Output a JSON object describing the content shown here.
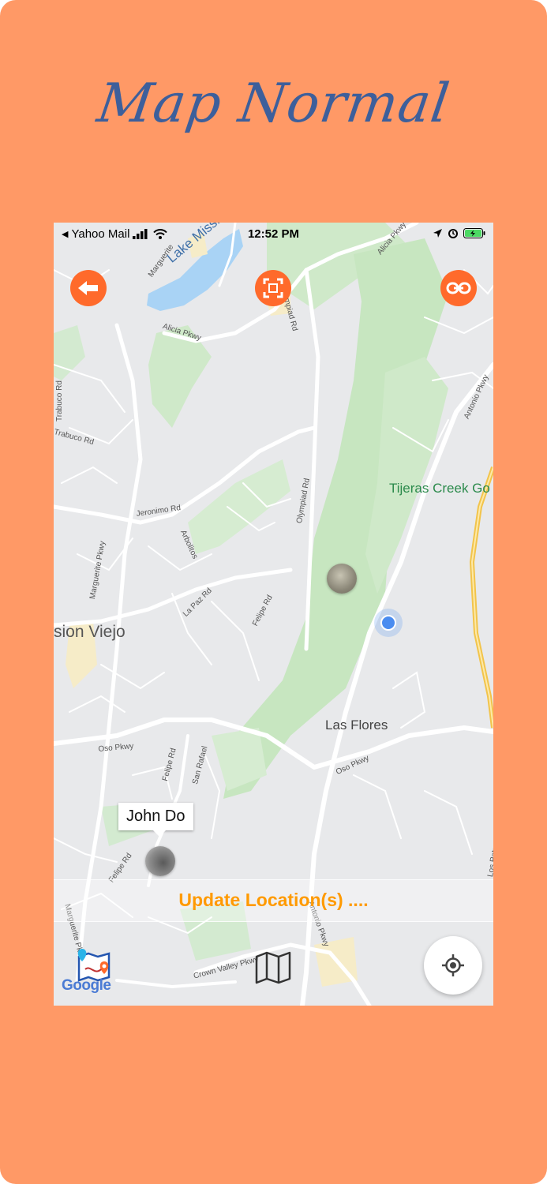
{
  "poster": {
    "title": "Map Normal",
    "background": "#FF9966",
    "title_color": "#3D5F9B"
  },
  "status_bar": {
    "back_app": "Yahoo Mail",
    "time": "12:52 PM"
  },
  "map_labels": {
    "lake": "Lake Mission Viejo",
    "city": "sion Viejo",
    "las_flores": "Las Flores",
    "tijeras": "Tijeras Creek Go",
    "roads": {
      "marguerite_top": "Marguerite",
      "alicia_top": "Alicia Pkwy",
      "alicia_left": "Alicia Pkwy",
      "olympiad_top": "Olympiad Rd",
      "olympiad_mid": "Olympiad Rd",
      "trabuco_vert": "Trabuco Rd",
      "trabuco_left": "Trabuco Rd",
      "jeronimo": "Jeronimo Rd",
      "marguerite_mid": "Marguerite Pkwy",
      "arbolitos": "Arbolitos",
      "la_paz": "La Paz Rd",
      "felipe_mid": "Felipe Rd",
      "felipe_low": "Felipe Rd",
      "felipe_bottom": "Felipe Rd",
      "oso_left": "Oso Pkwy",
      "oso_right": "Oso Pkwy",
      "san_rafael": "San Rafael",
      "antonio": "Antonio Pkwy",
      "crown_valley": "Crown Valley Pkwy",
      "marguerite_bottom": "Marguerite Pk",
      "antonio_bottom": "Antonio Pkwy",
      "los_patrones": "Los Patr"
    }
  },
  "marker_callout": "John Do",
  "update_banner": "Update Location(s) ....",
  "buttons": {
    "back": "arrow-left-icon",
    "fullscreen": "expand-icon",
    "share_link": "link-icon",
    "map_type": "map-icon",
    "my_location": "crosshair-icon"
  },
  "attribution": "Google",
  "colors": {
    "accent_button": "#FF6A2B",
    "update_text": "#FF9A00",
    "park_green": "#CBE8C6",
    "water": "#A9D3F5",
    "user_dot": "#4A8CF0"
  }
}
